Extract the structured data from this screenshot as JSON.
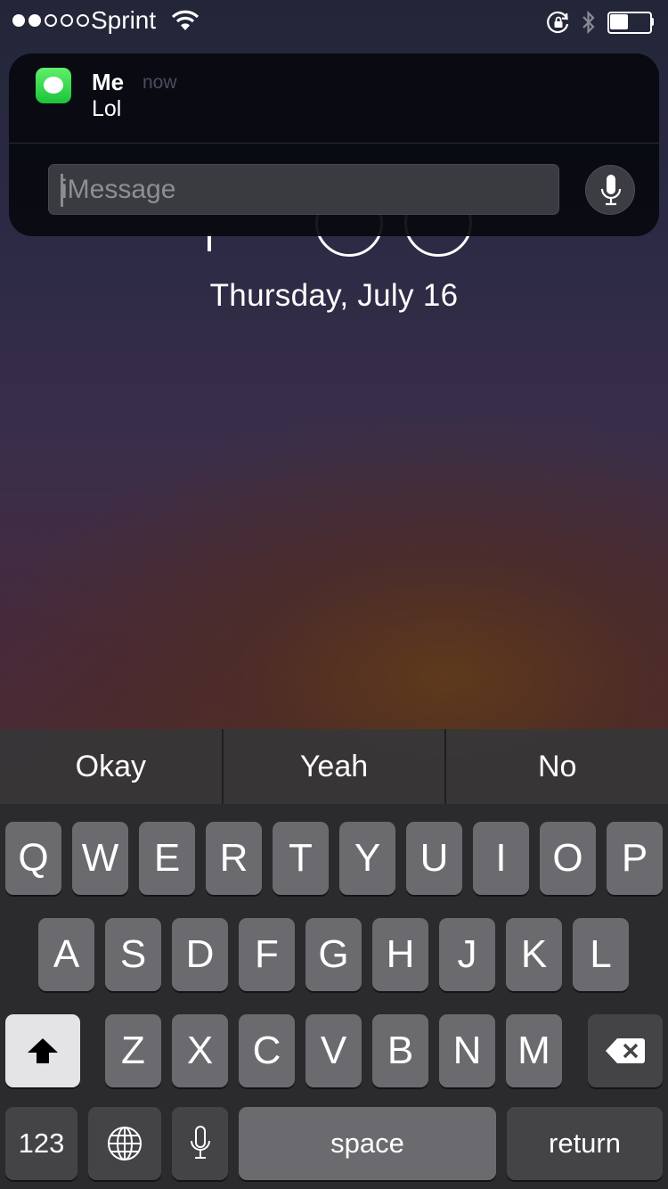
{
  "status_bar": {
    "signal_dots": [
      true,
      true,
      false,
      false,
      false
    ],
    "carrier": "Sprint",
    "battery_level": 0.5
  },
  "lock_screen": {
    "date": "Thursday, July 16"
  },
  "notification": {
    "app_icon": "messages-icon",
    "sender": "Me",
    "timestamp": "now",
    "message": "Lol",
    "reply_placeholder": "iMessage",
    "reply_value": "",
    "mic_icon": "microphone-icon",
    "accent_color": "#1fd04a"
  },
  "predictive": {
    "suggestions": [
      "Okay",
      "Yeah",
      "No"
    ]
  },
  "keyboard": {
    "row1": [
      "Q",
      "W",
      "E",
      "R",
      "T",
      "Y",
      "U",
      "I",
      "O",
      "P"
    ],
    "row2": [
      "A",
      "S",
      "D",
      "F",
      "G",
      "H",
      "J",
      "K",
      "L"
    ],
    "row3": [
      "Z",
      "X",
      "C",
      "V",
      "B",
      "N",
      "M"
    ],
    "shift_icon": "shift-arrow-icon",
    "delete_icon": "backspace-icon",
    "numbers_label": "123",
    "globe_icon": "globe-icon",
    "dictation_icon": "microphone-icon",
    "space_label": "space",
    "return_label": "return"
  }
}
